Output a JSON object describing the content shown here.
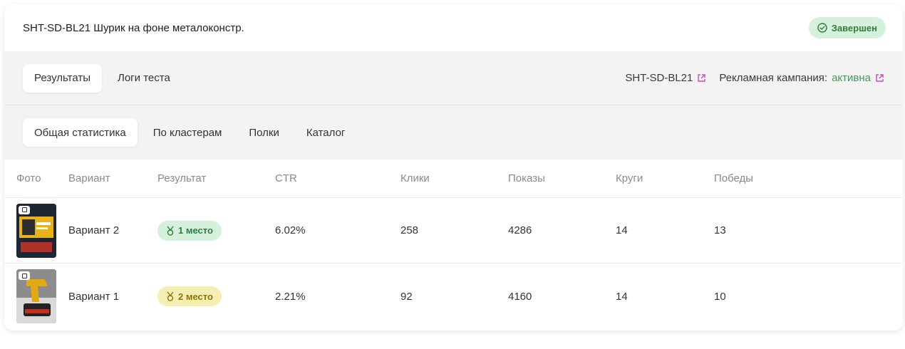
{
  "header": {
    "title": "SHT-SD-BL21 Шурик на фоне металоконстр.",
    "status": "Завершен"
  },
  "tabs": [
    {
      "label": "Результаты",
      "active": true
    },
    {
      "label": "Логи теста",
      "active": false
    }
  ],
  "links": {
    "sku": "SHT-SD-BL21",
    "campaign_label": "Рекламная кампания:",
    "campaign_status": "активна"
  },
  "subtabs": [
    {
      "label": "Общая статистика",
      "active": true
    },
    {
      "label": "По кластерам",
      "active": false
    },
    {
      "label": "Полки",
      "active": false
    },
    {
      "label": "Каталог",
      "active": false
    }
  ],
  "table": {
    "headers": [
      "Фото",
      "Вариант",
      "Результат",
      "CTR",
      "Клики",
      "Показы",
      "Круги",
      "Победы"
    ],
    "rows": [
      {
        "variant": "Вариант 2",
        "result": "1 место",
        "ctr": "6.02%",
        "clicks": "258",
        "shows": "4286",
        "rounds": "14",
        "wins": "13"
      },
      {
        "variant": "Вариант 1",
        "result": "2 место",
        "ctr": "2.21%",
        "clicks": "92",
        "shows": "4160",
        "rounds": "14",
        "wins": "10"
      }
    ]
  },
  "colors": {
    "accent_green": "#3f9b57",
    "badge_green_bg": "#d6f1db",
    "badge_yellow_bg": "#f6efb2",
    "external_link_icon": "#c04fc0"
  }
}
